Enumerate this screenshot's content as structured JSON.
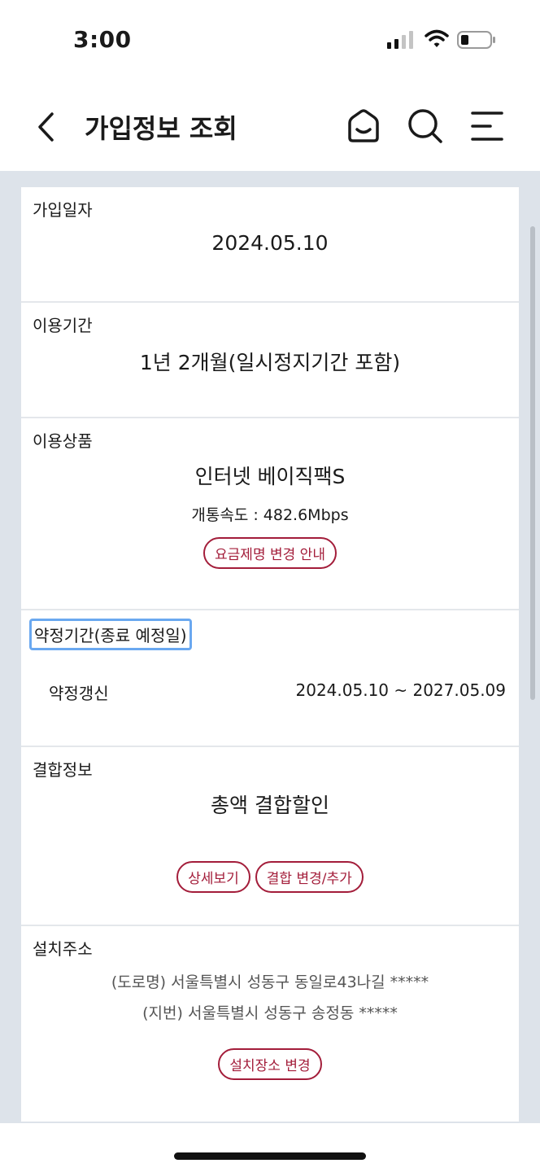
{
  "status_bar": {
    "time": "3:00"
  },
  "header": {
    "title": "가입정보 조회"
  },
  "sections": {
    "join_date": {
      "label": "가입일자",
      "value": "2024.05.10"
    },
    "usage_period": {
      "label": "이용기간",
      "value": "1년 2개월(일시정지기간 포함)"
    },
    "product": {
      "label": "이용상품",
      "name": "인터넷 베이직팩S",
      "speed": "개통속도 : 482.6Mbps",
      "button": "요금제명 변경 안내"
    },
    "contract": {
      "label": "약정기간(종료 예정일)",
      "type": "약정갱신",
      "period": "2024.05.10 ~ 2027.05.09"
    },
    "bundle": {
      "label": "결합정보",
      "value": "총액 결합할인",
      "buttons": [
        "상세보기",
        "결합 변경/추가"
      ]
    },
    "address": {
      "label": "설치주소",
      "road": "(도로명) 서울특별시 성동구 동일로43나길 *****",
      "lot": "(지번) 서울특별시 성동구 송정동 *****",
      "button": "설치장소 변경"
    }
  },
  "colors": {
    "accent": "#a31d3a",
    "background": "#dde3ea",
    "focus": "#6aa8f0"
  },
  "icons": [
    "back-icon",
    "home-icon",
    "search-icon",
    "menu-icon",
    "signal-icon",
    "wifi-icon",
    "battery-icon"
  ]
}
